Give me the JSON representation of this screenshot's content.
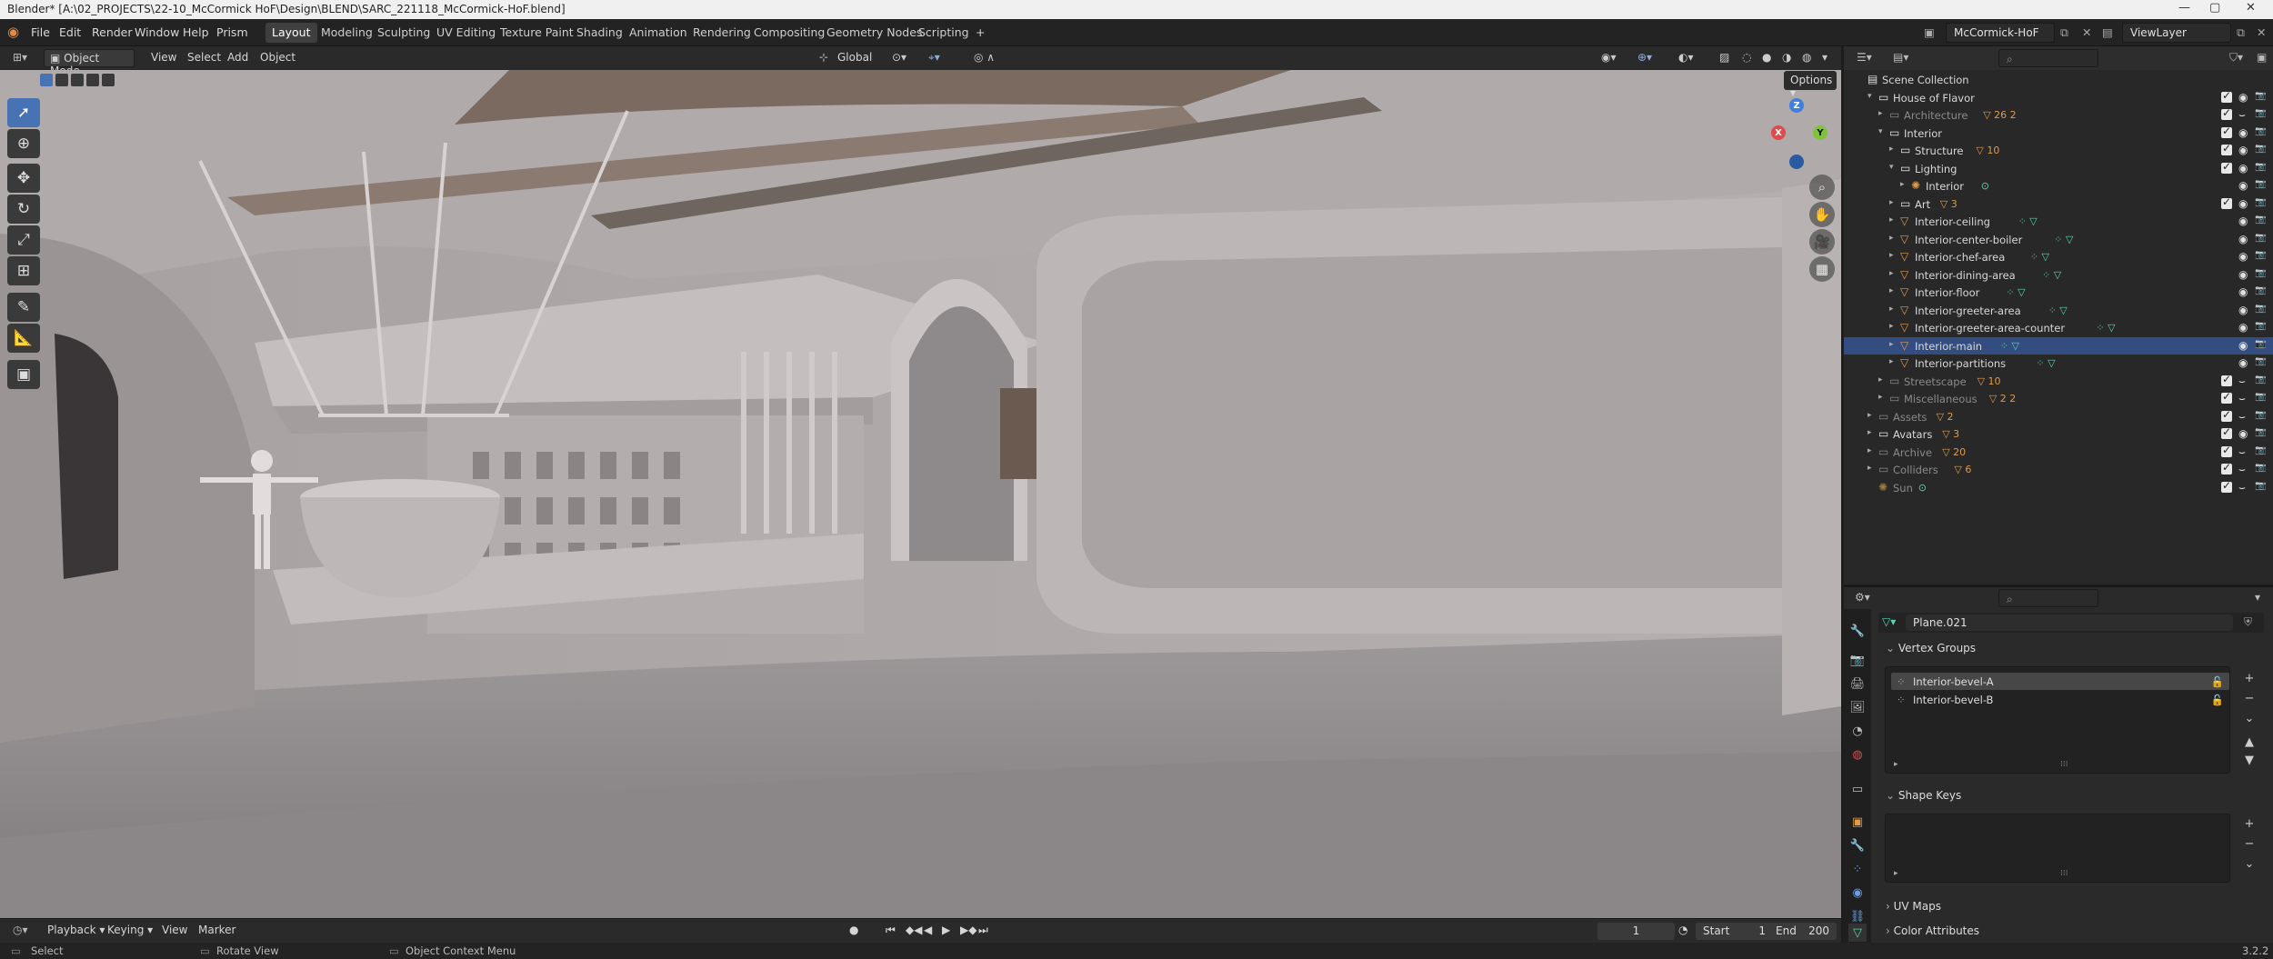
{
  "window": {
    "title": "Blender* [A:\\02_PROJECTS\\22-10_McCormick HoF\\Design\\BLEND\\SARC_221118_McCormick-HoF.blend]",
    "controls": [
      "—",
      "▢",
      "✕"
    ]
  },
  "menu": [
    "File",
    "Edit",
    "Render",
    "Window",
    "Help",
    "Prism"
  ],
  "workspaces": [
    {
      "label": "Layout",
      "active": true
    },
    {
      "label": "Modeling"
    },
    {
      "label": "Sculpting"
    },
    {
      "label": "UV Editing"
    },
    {
      "label": "Texture Paint"
    },
    {
      "label": "Shading"
    },
    {
      "label": "Animation"
    },
    {
      "label": "Rendering"
    },
    {
      "label": "Compositing"
    },
    {
      "label": "Geometry Nodes"
    },
    {
      "label": "Scripting"
    },
    {
      "label": "+"
    }
  ],
  "scene_field": "McCormick-HoF",
  "viewlayer_field": "ViewLayer",
  "viewport_header": {
    "mode": "Object Mode",
    "menus": [
      "View",
      "Select",
      "Add",
      "Object"
    ],
    "transform_orientation": "Global",
    "options": "Options"
  },
  "gizmo": {
    "z": "Z",
    "x": "X",
    "y": "Y"
  },
  "timeline": {
    "menus": [
      "Playback",
      "Keying",
      "View",
      "Marker"
    ],
    "current_frame": "1",
    "start_label": "Start",
    "start": "1",
    "end_label": "End",
    "end": "200"
  },
  "statusbar": {
    "items": [
      "Select",
      "Rotate View",
      "Object Context Menu"
    ],
    "version": "3.2.2"
  },
  "outliner": {
    "rows": [
      {
        "label": "Scene Collection",
        "depth": 0,
        "type": "scene"
      },
      {
        "label": "House of Flavor",
        "depth": 1,
        "expanded": true,
        "type": "collection"
      },
      {
        "label": "Architecture",
        "depth": 2,
        "dim": true,
        "type": "collection",
        "badges": "26 2"
      },
      {
        "label": "Interior",
        "depth": 2,
        "expanded": true,
        "type": "collection"
      },
      {
        "label": "Structure",
        "depth": 3,
        "type": "collection",
        "badges": "10"
      },
      {
        "label": "Lighting",
        "depth": 3,
        "expanded": true,
        "type": "collection"
      },
      {
        "label": "Interior",
        "depth": 4,
        "type": "light"
      },
      {
        "label": "Art",
        "depth": 3,
        "type": "collection",
        "badges": "3"
      },
      {
        "label": "Interior-ceiling",
        "depth": 3,
        "type": "mesh"
      },
      {
        "label": "Interior-center-boiler",
        "depth": 3,
        "type": "mesh"
      },
      {
        "label": "Interior-chef-area",
        "depth": 3,
        "type": "mesh"
      },
      {
        "label": "Interior-dining-area",
        "depth": 3,
        "type": "mesh"
      },
      {
        "label": "Interior-floor",
        "depth": 3,
        "type": "mesh"
      },
      {
        "label": "Interior-greeter-area",
        "depth": 3,
        "type": "mesh"
      },
      {
        "label": "Interior-greeter-area-counter",
        "depth": 3,
        "type": "mesh"
      },
      {
        "label": "Interior-main",
        "depth": 3,
        "type": "mesh",
        "selected": true
      },
      {
        "label": "Interior-partitions",
        "depth": 3,
        "type": "mesh"
      },
      {
        "label": "Streetscape",
        "depth": 2,
        "dim": true,
        "type": "collection",
        "badges": "10"
      },
      {
        "label": "Miscellaneous",
        "depth": 2,
        "dim": true,
        "type": "collection",
        "badges": "2 2"
      },
      {
        "label": "Assets",
        "depth": 1,
        "dim": true,
        "type": "collection",
        "badges": "2"
      },
      {
        "label": "Avatars",
        "depth": 1,
        "type": "collection",
        "badges": "3"
      },
      {
        "label": "Archive",
        "depth": 1,
        "dim": true,
        "type": "collection",
        "badges": "20"
      },
      {
        "label": "Colliders",
        "depth": 1,
        "dim": true,
        "type": "collection",
        "badges": "6"
      },
      {
        "label": "Sun",
        "depth": 1,
        "dim": true,
        "type": "light"
      }
    ]
  },
  "properties": {
    "data_name": "Plane.021",
    "vertex_groups_title": "Vertex Groups",
    "vertex_groups": [
      {
        "label": "Interior-bevel-A",
        "selected": true
      },
      {
        "label": "Interior-bevel-B"
      }
    ],
    "shape_keys_title": "Shape Keys",
    "uv_maps_title": "UV Maps",
    "color_attributes_title": "Color Attributes"
  },
  "colors": {
    "accent": "#4772b3",
    "selection": "#334d80",
    "viewport_bg": "#8f8a8b",
    "mesh_icon": "#e09a4a",
    "link_icon": "#5cd3b5"
  }
}
